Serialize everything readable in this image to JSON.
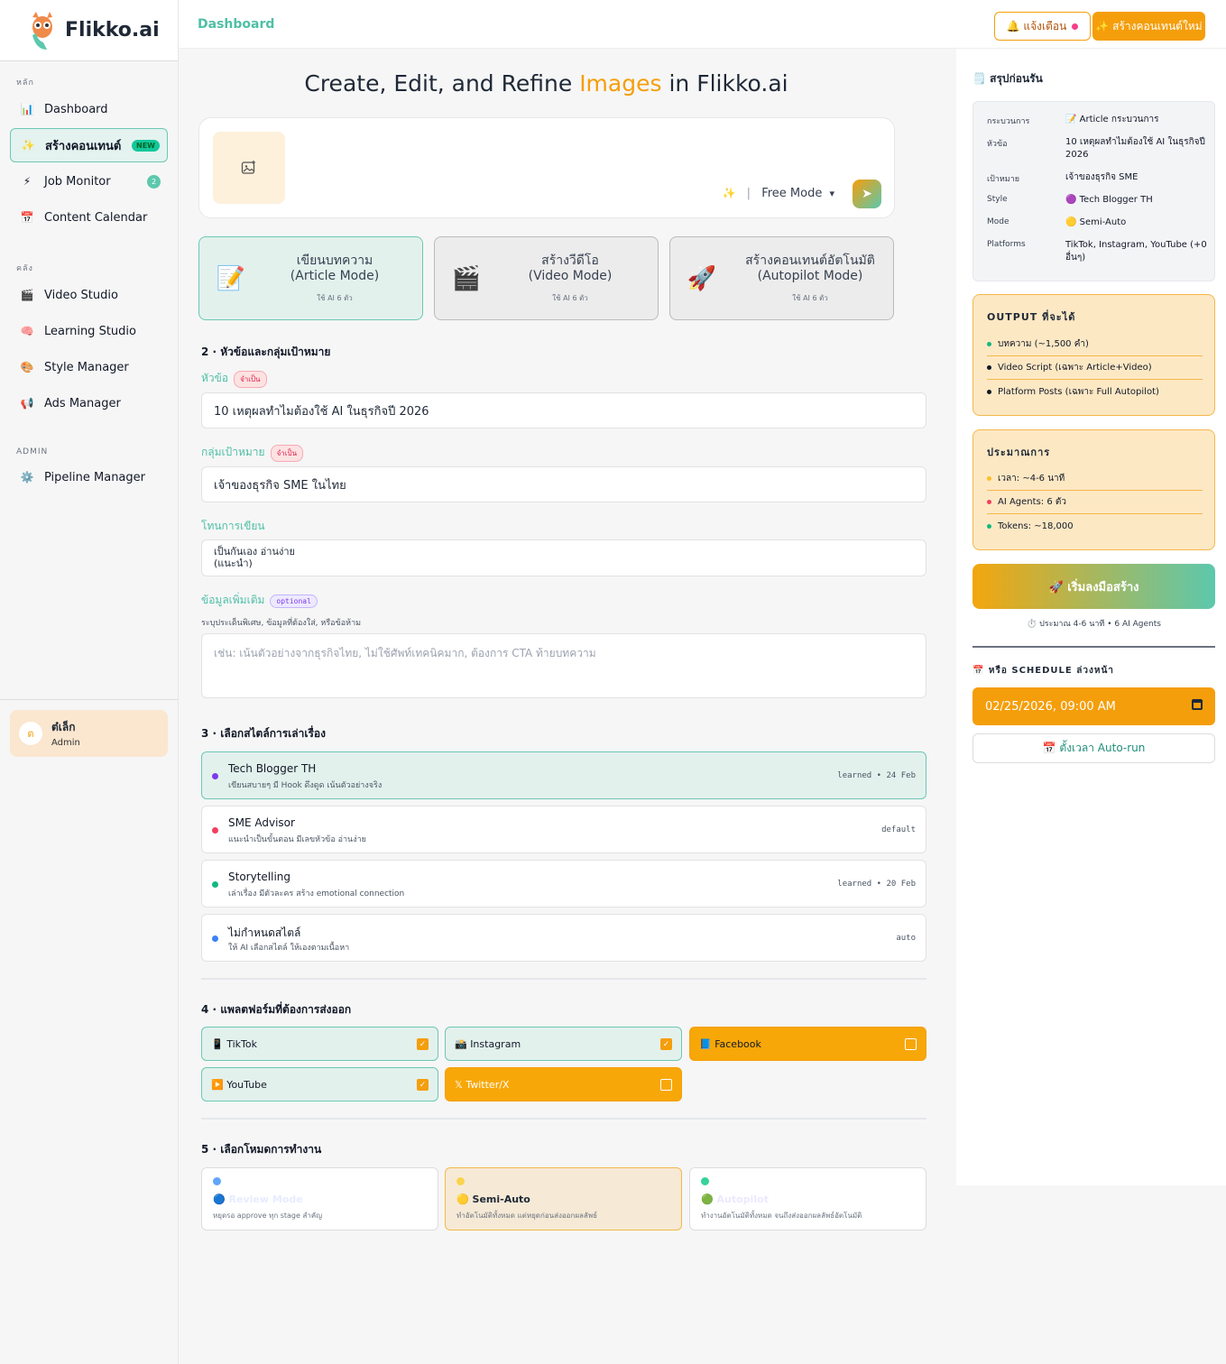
{
  "brand": {
    "name": "Flikko.ai"
  },
  "sidebar": {
    "sections": [
      {
        "label": "หลัก",
        "items": [
          {
            "label": "Dashboard",
            "icon": "📊"
          },
          {
            "label": "สร้างคอนเทนต์",
            "icon": "✨",
            "badge": "NEW",
            "active": true
          },
          {
            "label": "Job Monitor",
            "icon": "⚡",
            "badge": "2"
          },
          {
            "label": "Content Calendar",
            "icon": "📅"
          }
        ]
      },
      {
        "label": "คลัง",
        "items": [
          {
            "label": "Video Studio",
            "icon": "🎬"
          },
          {
            "label": "Learning Studio",
            "icon": "🧠"
          },
          {
            "label": "Style Manager",
            "icon": "🎨"
          },
          {
            "label": "Ads Manager",
            "icon": "📢"
          }
        ]
      },
      {
        "label": "ADMIN",
        "items": [
          {
            "label": "Pipeline Manager",
            "icon": "⚙️"
          }
        ]
      }
    ],
    "user": {
      "initial": "ต",
      "name": "ต๋เล็ก",
      "role": "Admin"
    }
  },
  "topbar": {
    "breadcrumb": "Dashboard",
    "notify_label": "🔔 แจ้งเตือน",
    "create_label": "✨ สร้างคอนเทนต์ใหม่"
  },
  "hero": {
    "pre": "Create, Edit, and Refine ",
    "highlight": "Images",
    "post": " in Flikko.ai"
  },
  "prompt": {
    "mode_label": "Free Mode",
    "upload_icon": "image-add-icon",
    "send_icon": "send-icon"
  },
  "modes": [
    {
      "icon": "📝",
      "title": "เขียนบทความ",
      "subtitle": "(Article Mode)",
      "note": "ใช้ AI 6 ตัว",
      "selected": true
    },
    {
      "icon": "🎬",
      "title": "สร้างวีดีโอ",
      "subtitle": "(Video Mode)",
      "note": "ใช้ AI 6 ตัว",
      "selected": false
    },
    {
      "icon": "🚀",
      "title": "สร้างคอนเทนต์อัตโนมัติ",
      "subtitle": "(Autopilot Mode)",
      "note": "ใช้ AI 6 ตัว",
      "selected": false
    }
  ],
  "form": {
    "section2": "2 · หัวข้อและกลุ่มเป้าหมาย",
    "topic_label": "หัวข้อ",
    "required": "จำเป็น",
    "topic_value": "10 เหตุผลทำไมต้องใช้ AI ในธุรกิจปี 2026",
    "audience_label": "กลุ่มเป้าหมาย",
    "audience_value": "เจ้าของธุรกิจ SME ในไทย",
    "tone_label": "โทนการเขียน",
    "tone_value": "เป็นกันเอง อ่านง่าย (แนะนำ)",
    "extra_label": "ข้อมูลเพิ่มเติม",
    "optional": "optional",
    "extra_hint": "ระบุประเด็นพิเศษ, ข้อมูลที่ต้องใส่, หรือข้อห้าม",
    "extra_placeholder": "เช่น: เน้นตัวอย่างจากธุรกิจไทย, ไม่ใช้ศัพท์เทคนิคมาก, ต้องการ CTA ท้ายบทความ",
    "section3": "3 · เลือกสไตล์การเล่าเรื่อง",
    "styles": [
      {
        "name": "Tech Blogger TH",
        "desc": "เขียนสบายๆ มี Hook ดึงดูด เน้นตัวอย่างจริง",
        "tag": "learned • 24 Feb",
        "color": "#7c3aed",
        "selected": true
      },
      {
        "name": "SME Advisor",
        "desc": "แนะนำเป็นขั้นตอน มีเลขหัวข้อ อ่านง่าย",
        "tag": "default",
        "color": "#f43f5e",
        "selected": false
      },
      {
        "name": "Storytelling",
        "desc": "เล่าเรื่อง มีตัวละคร สร้าง emotional connection",
        "tag": "learned • 20 Feb",
        "color": "#10b981",
        "selected": false
      },
      {
        "name": "ไม่กำหนดสไตล์",
        "desc": "ให้ AI เลือกสไตล์ ให้เองตามเนื้อหา",
        "tag": "auto",
        "color": "#3b82f6",
        "selected": false
      }
    ],
    "section4": "4 · แพลตฟอร์มที่ต้องการส่งออก",
    "platforms": [
      {
        "label": "📱 TikTok",
        "checked": true
      },
      {
        "label": "📸 Instagram",
        "checked": true
      },
      {
        "label": "📘 Facebook",
        "checked": false
      },
      {
        "label": "▶️ YouTube",
        "checked": true
      },
      {
        "label": "𝕏 Twitter/X",
        "checked": false
      }
    ],
    "section5": "5 · เลือกโหมดการทำงาน",
    "work_modes": [
      {
        "name": "🔵 Review Mode",
        "desc": "หยุดรอ approve ทุก stage สำคัญ",
        "color": "#60a5fa",
        "selected": false,
        "name_color": "#eef2ff"
      },
      {
        "name": "🟡 Semi-Auto",
        "desc": "ทำอัตโนมัติทั้งหมด แต่หยุดก่อนส่งออกผลลัพธ์",
        "color": "#fcd34d",
        "selected": true,
        "name_color": "#111827"
      },
      {
        "name": "🟢 Autopilot",
        "desc": "ทำงานอัตโนมัติทั้งหมด จนถึงส่งออกผลลัพธ์อัตโนมัติ",
        "color": "#34d399",
        "selected": false,
        "name_color": "#f1f0ff"
      }
    ]
  },
  "summary": {
    "title": "🗒️ สรุปก่อนรัน",
    "rows": [
      {
        "k": "กระบวนการ",
        "v": "📝 Article กระบวนการ"
      },
      {
        "k": "หัวข้อ",
        "v": "10 เหตุผลทำไมต้องใช้ AI ในธุรกิจปี 2026"
      },
      {
        "k": "เป้าหมาย",
        "v": "เจ้าของธุรกิจ SME"
      },
      {
        "k": "Style",
        "v": "🟣 Tech Blogger TH"
      },
      {
        "k": "Mode",
        "v": "🟡 Semi-Auto"
      },
      {
        "k": "Platforms",
        "v": "TikTok, Instagram, YouTube (+0 อื่นๆ)"
      }
    ],
    "output_title": "OUTPUT ที่จะได้",
    "outputs": [
      {
        "text": "บทความ (~1,500 คำ)",
        "color": "#10b981"
      },
      {
        "text": "Video Script (เฉพาะ Article+Video)",
        "color": "#111827"
      },
      {
        "text": "Platform Posts (เฉพาะ Full Autopilot)",
        "color": "#111827"
      }
    ],
    "estimate_title": "ประมาณการ",
    "estimates": [
      {
        "text": "เวลา: ~4-6 นาที",
        "color": "#fbbf24"
      },
      {
        "text": "AI Agents: 6 ตัว",
        "color": "#f43f5e"
      },
      {
        "text": "Tokens: ~18,000",
        "color": "#10b981"
      }
    ],
    "start_label": "🚀 เริ่มลงมือสร้าง",
    "start_note": "⏱️ ประมาณ 4-6 นาที • 6 AI Agents",
    "schedule_title": "📅 หรือ SCHEDULE ล่วงหน้า",
    "schedule_value": "02/25/2026, 09:00 AM",
    "autorun_label": "📅 ตั้งเวลา Auto-run"
  },
  "colors": {
    "accent": "#f59e0b",
    "teal": "#4fbfa6"
  }
}
